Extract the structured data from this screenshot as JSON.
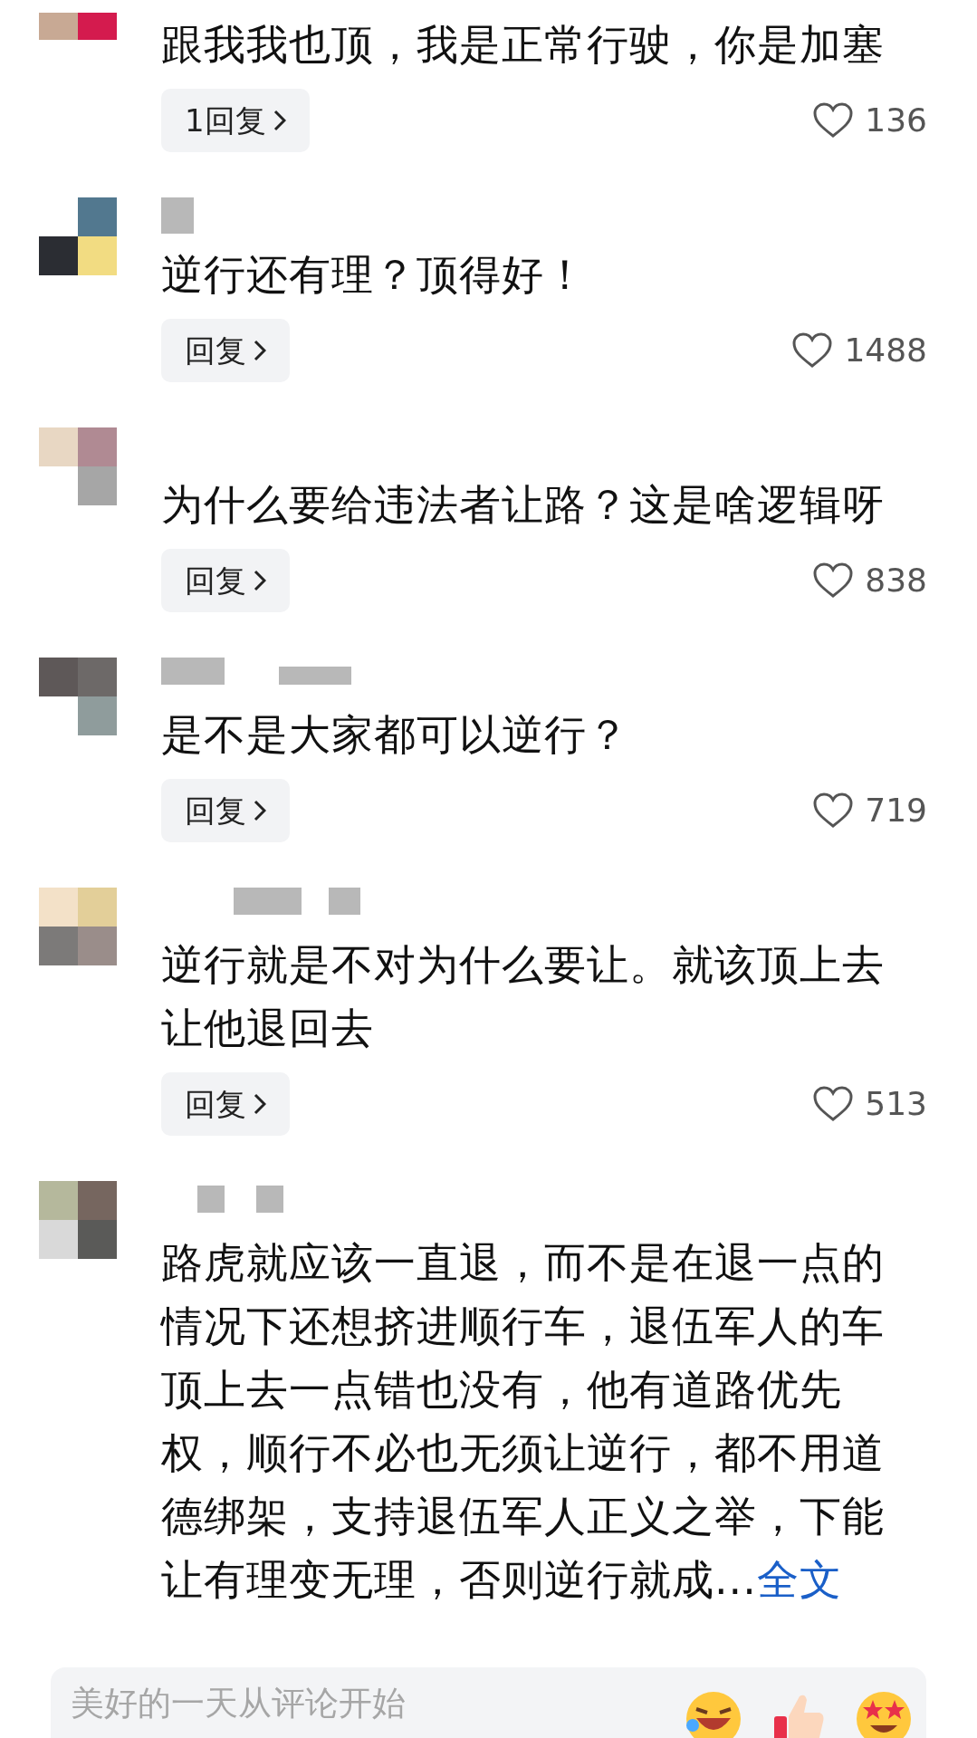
{
  "comments": [
    {
      "text": "跟我我也顶，我是正常行驶，你是加塞",
      "reply_button": "1回复",
      "likes": "136"
    },
    {
      "text": "逆行还有理？顶得好！",
      "reply_button": "回复",
      "likes": "1488"
    },
    {
      "text": "为什么要给违法者让路？这是啥逻辑呀",
      "reply_button": "回复",
      "likes": "838"
    },
    {
      "text": "是不是大家都可以逆行？",
      "reply_button": "回复",
      "likes": "719"
    },
    {
      "text": "逆行就是不对为什么要让。就该顶上去让他退回去",
      "reply_button": "回复",
      "likes": "513"
    },
    {
      "text": "路虎就应该一直退，而不是在退一点的情况下还想挤进顺行车，退伍军人的车顶上去一点错也没有，他有道路优先权，顺行不必也无须让逆行，都不用道德绑架，支持退伍军人正义之举，下能让有理变无理，否则逆行就成...",
      "more_link": "全文"
    }
  ],
  "input_bar": {
    "placeholder": "美好的一天从评论开始"
  }
}
